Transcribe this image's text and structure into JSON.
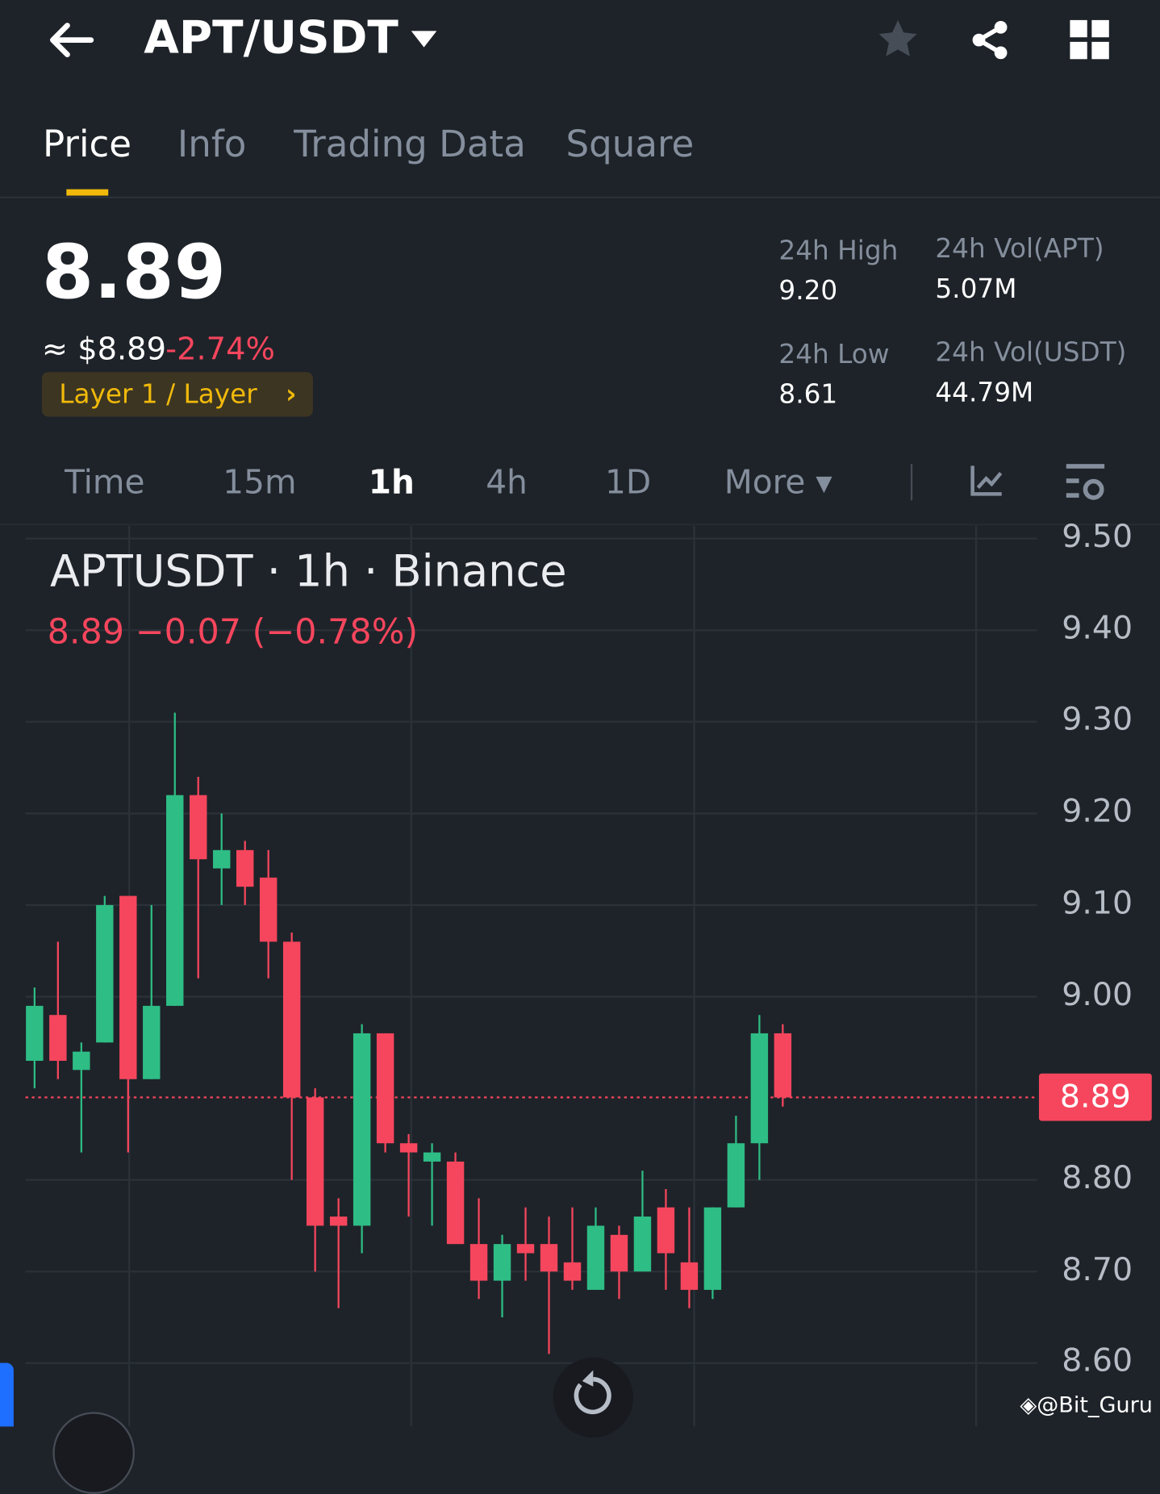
{
  "header": {
    "title": "APT/USDT",
    "back_icon": "arrow-left-icon",
    "dropdown_icon": "caret-down-icon",
    "icons": [
      "star-icon",
      "share-icon",
      "grid-icon"
    ]
  },
  "tabs": [
    {
      "label": "Price"
    },
    {
      "label": "Info"
    },
    {
      "label": "Trading Data"
    },
    {
      "label": "Square"
    }
  ],
  "ticker": {
    "price": "8.89",
    "usd": "≈ $8.89",
    "change": "-2.74%",
    "tag": "Layer 1 / Layer",
    "tag_chevron": "›",
    "stats": [
      {
        "label": "24h High",
        "value": "9.20"
      },
      {
        "label": "24h Vol(APT)",
        "value": "5.07M"
      },
      {
        "label": "24h Low",
        "value": "8.61"
      },
      {
        "label": "24h Vol(USDT)",
        "value": "44.79M"
      }
    ]
  },
  "intervals": [
    {
      "label": "Time"
    },
    {
      "label": "15m"
    },
    {
      "label": "1h"
    },
    {
      "label": "4h"
    },
    {
      "label": "1D"
    },
    {
      "label": "More ▾"
    }
  ],
  "colors": {
    "up": "#2ebd85",
    "down": "#f6465d",
    "accent": "#f0b90b",
    "bg": "#1e2329"
  },
  "chart_data": {
    "type": "candlestick",
    "title": "APTUSDT · 1h · Binance",
    "summary": "8.89  −0.07 (−0.78%)",
    "last_price": "8.89",
    "ylim": [
      8.6,
      9.5
    ],
    "y_ticks": [
      "9.50",
      "9.40",
      "9.30",
      "9.20",
      "9.10",
      "9.00",
      "8.80",
      "8.70",
      "8.60"
    ],
    "candles": [
      [
        8.93,
        9.01,
        8.9,
        8.99
      ],
      [
        8.98,
        9.06,
        8.91,
        8.93
      ],
      [
        8.92,
        8.95,
        8.83,
        8.94
      ],
      [
        8.95,
        9.11,
        8.95,
        9.1
      ],
      [
        9.11,
        9.11,
        8.83,
        8.91
      ],
      [
        8.91,
        9.1,
        8.91,
        8.99
      ],
      [
        8.99,
        9.31,
        8.99,
        9.22
      ],
      [
        9.22,
        9.24,
        9.02,
        9.15
      ],
      [
        9.14,
        9.2,
        9.1,
        9.16
      ],
      [
        9.16,
        9.17,
        9.1,
        9.12
      ],
      [
        9.13,
        9.16,
        9.02,
        9.06
      ],
      [
        9.06,
        9.07,
        8.8,
        8.89
      ],
      [
        8.89,
        8.9,
        8.7,
        8.75
      ],
      [
        8.76,
        8.78,
        8.66,
        8.75
      ],
      [
        8.75,
        8.97,
        8.72,
        8.96
      ],
      [
        8.96,
        8.96,
        8.83,
        8.84
      ],
      [
        8.84,
        8.85,
        8.76,
        8.83
      ],
      [
        8.82,
        8.84,
        8.75,
        8.83
      ],
      [
        8.82,
        8.83,
        8.73,
        8.73
      ],
      [
        8.73,
        8.78,
        8.67,
        8.69
      ],
      [
        8.69,
        8.74,
        8.65,
        8.73
      ],
      [
        8.73,
        8.77,
        8.69,
        8.72
      ],
      [
        8.73,
        8.76,
        8.61,
        8.7
      ],
      [
        8.71,
        8.77,
        8.68,
        8.69
      ],
      [
        8.68,
        8.77,
        8.68,
        8.75
      ],
      [
        8.74,
        8.75,
        8.67,
        8.7
      ],
      [
        8.7,
        8.81,
        8.7,
        8.76
      ],
      [
        8.77,
        8.79,
        8.68,
        8.72
      ],
      [
        8.71,
        8.77,
        8.66,
        8.68
      ],
      [
        8.68,
        8.77,
        8.67,
        8.77
      ],
      [
        8.77,
        8.87,
        8.77,
        8.84
      ],
      [
        8.84,
        8.98,
        8.8,
        8.96
      ],
      [
        8.96,
        8.97,
        8.88,
        8.89
      ]
    ]
  },
  "watermark": "@Bit_Guru"
}
